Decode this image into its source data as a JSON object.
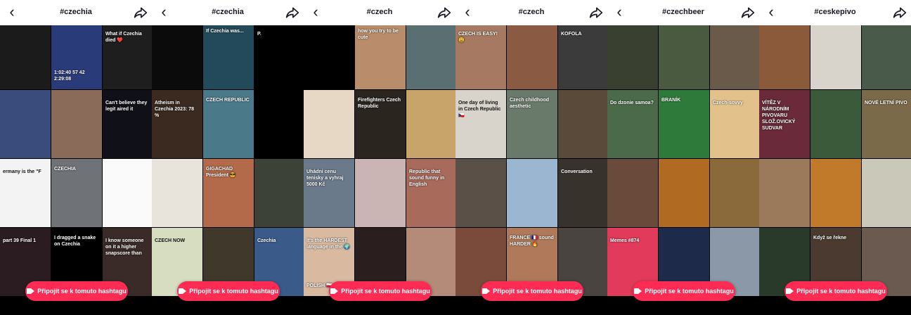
{
  "panels": [
    {
      "title": "#czechia",
      "cta": "Připojit se k tomuto hashtagu",
      "tiles": [
        {
          "bg": "#1b1b1b",
          "cap": "",
          "cap2": ""
        },
        {
          "bg": "#2a3b7a",
          "cap": "",
          "cap2": "1:02:40 57 42 2:29:08"
        },
        {
          "bg": "#1e1e1e",
          "cap": "What if Czechia died ❤️",
          "cap2": ""
        },
        {
          "bg": "#3a4c7c",
          "cap": "",
          "cap2": ""
        },
        {
          "bg": "#8a6b5a",
          "cap": "",
          "cap2": ""
        },
        {
          "bg": "#101018",
          "cap": "Can't believe they legit aired it",
          "cap2": ""
        },
        {
          "bg": "#f3f3f3",
          "cap": "ermany is the \"F",
          "cap2": ""
        },
        {
          "bg": "#6f7276",
          "cap": "CZECHIA",
          "cap2": ""
        },
        {
          "bg": "#fafafa",
          "cap": "",
          "cap2": ""
        },
        {
          "bg": "#2a1c20",
          "cap": "part 39 Final 1",
          "cap2": ""
        },
        {
          "bg": "#000000",
          "cap": "I dragged a snake on Czechia",
          "cap2": ""
        },
        {
          "bg": "#3a2b28",
          "cap": "I know someone on it a higher snapscore than",
          "cap2": ""
        }
      ]
    },
    {
      "title": "#czechia",
      "cta": "Připojit se k tomuto hashtagu",
      "tiles": [
        {
          "bg": "#0b0b0b",
          "cap": "",
          "cap2": ""
        },
        {
          "bg": "#234a5a",
          "cap": "If Czechia was...",
          "cap2": ""
        },
        {
          "bg": "#000000",
          "cap": "P.",
          "cap2": ""
        },
        {
          "bg": "#3a2a20",
          "cap": "Atheism in Czechia 2023: 78 %",
          "cap2": ""
        },
        {
          "bg": "#4a7a8a",
          "cap": "CZECH REPUBLIC",
          "cap2": ""
        },
        {
          "bg": "#000000",
          "cap": "",
          "cap2": ""
        },
        {
          "bg": "#e8e4dc",
          "cap": "",
          "cap2": ""
        },
        {
          "bg": "#b26a4a",
          "cap": "GIGACHAD President 😎",
          "cap2": ""
        },
        {
          "bg": "#3c4238",
          "cap": "",
          "cap2": ""
        },
        {
          "bg": "#d7ddc0",
          "cap": "CZECH NOW",
          "cap2": ""
        },
        {
          "bg": "#40382a",
          "cap": "",
          "cap2": ""
        },
        {
          "bg": "#3a5a8a",
          "cap": "Czechia",
          "cap2": ""
        }
      ]
    },
    {
      "title": "#czech",
      "cta": "Připojit se k tomuto hashtagu",
      "tiles": [
        {
          "bg": "#000000",
          "cap": "",
          "cap2": ""
        },
        {
          "bg": "#b98d6b",
          "cap": "how you try to be cute",
          "cap2": ""
        },
        {
          "bg": "#5a6f72",
          "cap": "",
          "cap2": ""
        },
        {
          "bg": "#e6d8c5",
          "cap": "",
          "cap2": ""
        },
        {
          "bg": "#2b2520",
          "cap": "Firefighters Czech Republic",
          "cap2": ""
        },
        {
          "bg": "#c8a46a",
          "cap": "",
          "cap2": ""
        },
        {
          "bg": "#6a7a8a",
          "cap": "Uhádni cenu tenisky a vyhraj 5000 Kč",
          "cap2": ""
        },
        {
          "bg": "#cbb4b4",
          "cap": "",
          "cap2": ""
        },
        {
          "bg": "#a86a5a",
          "cap": "Republic that sound funny in English",
          "cap2": ""
        },
        {
          "bg": "#d9b9a0",
          "cap": "It's the HARDEST language in the 🌍",
          "cap2": "POLISH 🇵🇱"
        },
        {
          "bg": "#2a1e1e",
          "cap": "",
          "cap2": ""
        },
        {
          "bg": "#b48a78",
          "cap": "",
          "cap2": ""
        }
      ]
    },
    {
      "title": "#czech",
      "cta": "Připojit se k tomuto hashtagu",
      "tiles": [
        {
          "bg": "#a67a62",
          "cap": "CZECH IS EASY! 😩",
          "cap2": ""
        },
        {
          "bg": "#8a5a42",
          "cap": "",
          "cap2": ""
        },
        {
          "bg": "#3b3b3b",
          "cap": "KOFOLA",
          "cap2": ""
        },
        {
          "bg": "#d8d4cc",
          "cap": "One day of living in Czech Republic 🇨🇿",
          "cap2": ""
        },
        {
          "bg": "#6a7a6a",
          "cap": "Czech childhood aesthetic",
          "cap2": ""
        },
        {
          "bg": "#5a4a3a",
          "cap": "",
          "cap2": ""
        },
        {
          "bg": "#5a5048",
          "cap": "",
          "cap2": ""
        },
        {
          "bg": "#9ab6d0",
          "cap": "",
          "cap2": ""
        },
        {
          "bg": "#38322c",
          "cap": "Conversation",
          "cap2": ""
        },
        {
          "bg": "#7a4a3a",
          "cap": "",
          "cap2": ""
        },
        {
          "bg": "#b07a5a",
          "cap": "FRANCE 🇫🇷 sound HARDER 🔥",
          "cap2": ""
        },
        {
          "bg": "#4a4440",
          "cap": "",
          "cap2": ""
        }
      ]
    },
    {
      "title": "#czechbeer",
      "cta": "Připojit se k tomuto hashtagu",
      "tiles": [
        {
          "bg": "#3a4030",
          "cap": "",
          "cap2": ""
        },
        {
          "bg": "#4a5a40",
          "cap": "",
          "cap2": ""
        },
        {
          "bg": "#6a5a4a",
          "cap": "",
          "cap2": ""
        },
        {
          "bg": "#4a6a4a",
          "cap": "Do dzonie samoa?",
          "cap2": ""
        },
        {
          "bg": "#2e7a3a",
          "cap": "BRANÍK",
          "cap2": ""
        },
        {
          "bg": "#e2c28a",
          "cap": "Czech-sovvy",
          "cap2": ""
        },
        {
          "bg": "#6a4a3a",
          "cap": "",
          "cap2": ""
        },
        {
          "bg": "#b06a22",
          "cap": "",
          "cap2": ""
        },
        {
          "bg": "#8a6a3a",
          "cap": "",
          "cap2": ""
        },
        {
          "bg": "#e23a5a",
          "cap": "Memes #874",
          "cap2": ""
        },
        {
          "bg": "#1e2a4a",
          "cap": "",
          "cap2": ""
        },
        {
          "bg": "#8a98a8",
          "cap": "",
          "cap2": ""
        }
      ]
    },
    {
      "title": "#ceskepivo",
      "cta": "Připojit se k tomuto hashtagu",
      "tiles": [
        {
          "bg": "#8a5a3a",
          "cap": "",
          "cap2": ""
        },
        {
          "bg": "#d8d4cc",
          "cap": "",
          "cap2": ""
        },
        {
          "bg": "#4a5a4a",
          "cap": "",
          "cap2": ""
        },
        {
          "bg": "#6a2a3a",
          "cap": "VÍTĚZ V NÁRODNÍM PIVOVARU SLOŽ.OVICKÝ SUDVAR",
          "cap2": ""
        },
        {
          "bg": "#3a5a3a",
          "cap": "",
          "cap2": ""
        },
        {
          "bg": "#7a6a4a",
          "cap": "NOVÉ LETNÍ PIVO",
          "cap2": ""
        },
        {
          "bg": "#9a7a5a",
          "cap": "",
          "cap2": ""
        },
        {
          "bg": "#c07a2a",
          "cap": "",
          "cap2": ""
        },
        {
          "bg": "#cac8b8",
          "cap": "",
          "cap2": ""
        },
        {
          "bg": "#2a3a2a",
          "cap": "",
          "cap2": ""
        },
        {
          "bg": "#4a3a30",
          "cap": "Když se řekne",
          "cap2": ""
        },
        {
          "bg": "#6a5a50",
          "cap": "",
          "cap2": ""
        }
      ]
    }
  ]
}
